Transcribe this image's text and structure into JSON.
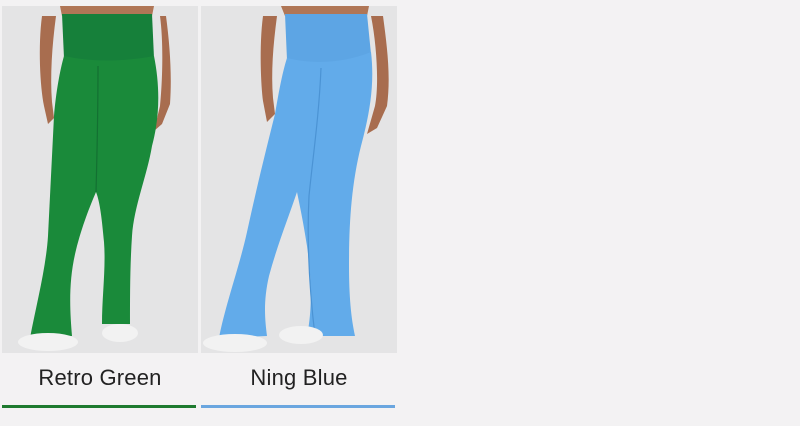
{
  "products": [
    {
      "name": "Retro Green",
      "color": "#1a8a3a",
      "underline_color": "#1e7a2f"
    },
    {
      "name": "Ning Blue",
      "color": "#5fa8e6",
      "underline_color": "#6aa6df"
    }
  ],
  "colors": {
    "background": "#f3f2f3",
    "photo_bg": "#e4e4e5",
    "skin": "#b07656",
    "shoe": "#f2f2f2"
  }
}
